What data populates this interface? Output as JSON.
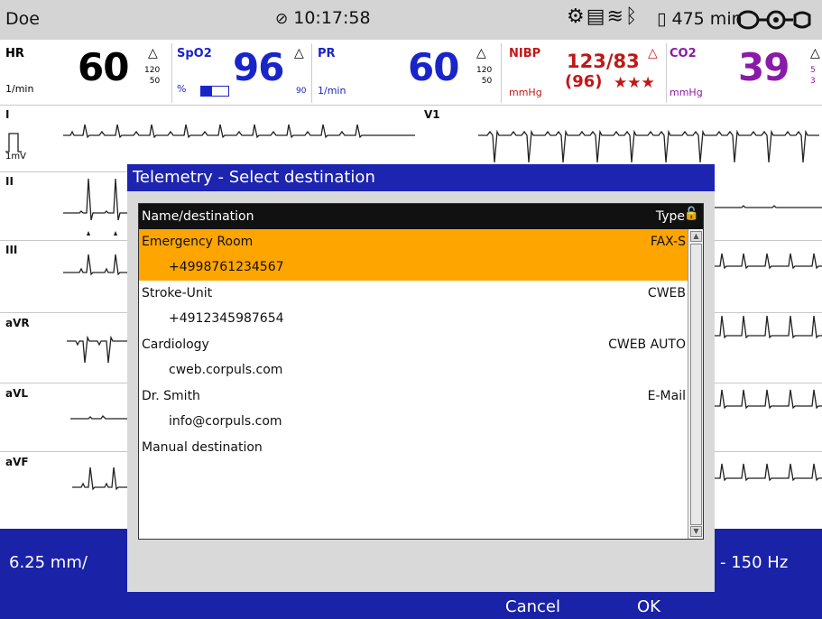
{
  "status_bar": {
    "patient_name": "Doe",
    "clock_icon": "clock-icon",
    "time": "10:17:58",
    "battery_time": "475 min"
  },
  "vitals": {
    "hr": {
      "label": "HR",
      "unit": "1/min",
      "value": "60",
      "limit_high": "120",
      "limit_low": "50"
    },
    "spo2": {
      "label": "SpO2",
      "unit": "%",
      "value": "96"
    },
    "pr": {
      "label": "PR",
      "unit": "1/min",
      "value": "60",
      "limit_low": "90",
      "limit_high": "120",
      "limit_low2": "50"
    },
    "nibp": {
      "label": "NIBP",
      "unit": "mmHg",
      "value": "123/83",
      "mean": "(96)",
      "stars": "★★★"
    },
    "co2": {
      "label": "CO2",
      "unit": "mmHg",
      "value": "39",
      "lim_a": "5",
      "lim_b": "3"
    }
  },
  "leads": {
    "l1": "I",
    "l2": "II",
    "l3": "III",
    "l4": "aVR",
    "l5": "aVL",
    "l6": "aVF",
    "v1": "V1",
    "cal": "1mV"
  },
  "bottom": {
    "speed": "6.25 mm/",
    "filter": "- 150 Hz",
    "cancel": "Cancel",
    "ok": "OK"
  },
  "dialog": {
    "title": "Telemetry - Select destination",
    "col_name": "Name/destination",
    "col_type": "Type",
    "rows": [
      {
        "name": "Emergency Room",
        "dest": "+4998761234567",
        "type": "FAX-S"
      },
      {
        "name": "Stroke-Unit",
        "dest": "+4912345987654",
        "type": "CWEB"
      },
      {
        "name": "Cardiology",
        "dest": "cweb.corpuls.com",
        "type": "CWEB AUTO"
      },
      {
        "name": "Dr. Smith",
        "dest": "info@corpuls.com",
        "type": "E-Mail"
      }
    ],
    "manual": "Manual destination"
  }
}
